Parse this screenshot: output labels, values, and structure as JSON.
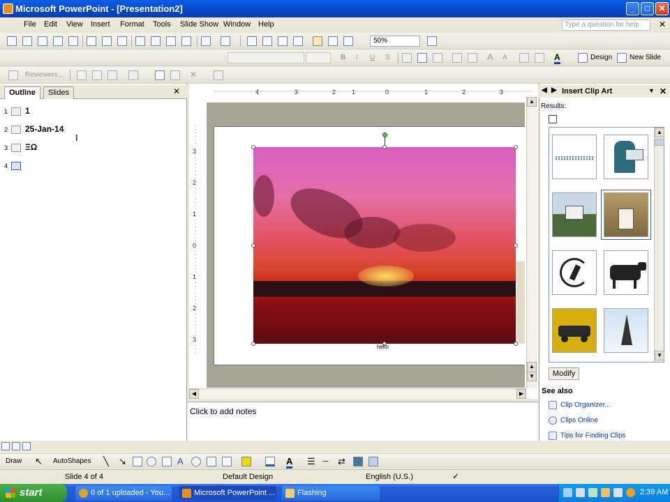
{
  "window": {
    "title": "Microsoft PowerPoint - [Presentation2]"
  },
  "menu": {
    "items": [
      "File",
      "Edit",
      "View",
      "Insert",
      "Format",
      "Tools",
      "Slide Show",
      "Window",
      "Help"
    ],
    "help_placeholder": "Type a question for help"
  },
  "toolbar": {
    "zoom": "50%",
    "design_label": "Design",
    "new_slide_label": "New Slide",
    "reviewers_label": "Reviewers..."
  },
  "outline": {
    "tabs": [
      "Outline",
      "Slides"
    ],
    "items": [
      {
        "num": "1",
        "text": "1"
      },
      {
        "num": "2",
        "text": "25-Jan-14"
      },
      {
        "num": "3",
        "text": "ΞΩ"
      },
      {
        "num": "4",
        "text": ""
      }
    ]
  },
  "slide": {
    "caption": "hello"
  },
  "notes": {
    "placeholder": "Click to add notes"
  },
  "taskpane": {
    "title": "Insert Clip Art",
    "results_label": "Results:",
    "modify_label": "Modify",
    "see_also": "See also",
    "links": [
      "Clip Organizer...",
      "Clips Online",
      "Tips for Finding Clips"
    ]
  },
  "drawbar": {
    "draw_label": "Draw",
    "autoshapes_label": "AutoShapes"
  },
  "status": {
    "slide": "Slide 4 of 4",
    "design": "Default Design",
    "language": "English (U.S.)"
  },
  "taskbar": {
    "start": "start",
    "buttons": [
      "0 of 1 uploaded - You...",
      "Microsoft PowerPoint ...",
      "Flashing"
    ],
    "clock": "2:39 AM"
  },
  "icons": [
    "app-icon",
    "minimize-icon",
    "maximize-icon",
    "close-icon",
    "new-icon",
    "open-icon",
    "save-icon",
    "print-icon",
    "cut-icon",
    "copy-icon",
    "paste-icon",
    "undo-icon",
    "chart-icon",
    "table-icon",
    "bold-icon",
    "italic-icon",
    "underline-icon",
    "font-color-icon",
    "windows-flag-icon"
  ]
}
